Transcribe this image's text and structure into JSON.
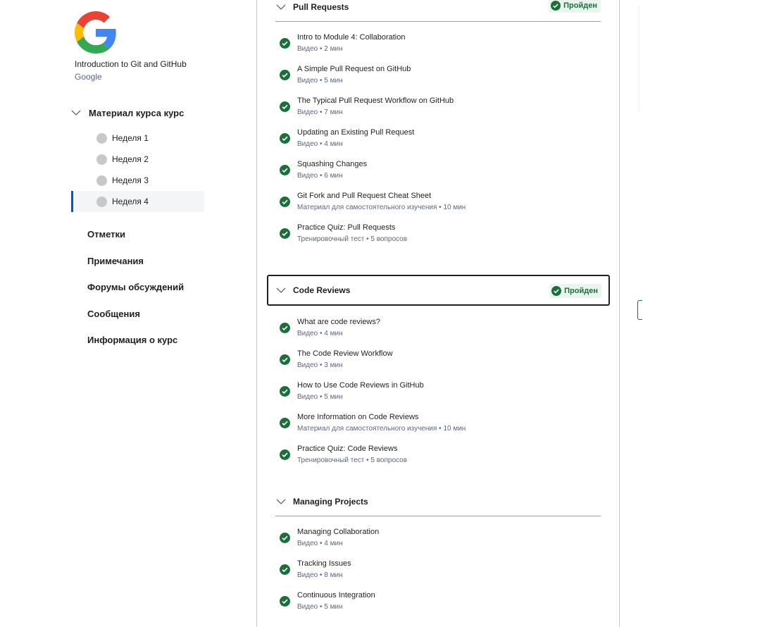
{
  "sidebar": {
    "course_title": "Introduction to Git and GitHub",
    "course_org": "Google",
    "material_label": "Материал курса курс",
    "weeks": [
      {
        "label": "Неделя 1"
      },
      {
        "label": "Неделя 2"
      },
      {
        "label": "Неделя 3"
      },
      {
        "label": "Неделя 4"
      }
    ],
    "links": [
      {
        "label": "Отметки"
      },
      {
        "label": "Примечания"
      },
      {
        "label": "Форумы обсуждений"
      },
      {
        "label": "Сообщения"
      },
      {
        "label": "Информация о курс"
      }
    ]
  },
  "status_label": "Пройден",
  "modules": [
    {
      "title": "Pull Requests",
      "items": [
        {
          "title": "Intro to Module 4: Collaboration",
          "meta": "Видео • 2 мин"
        },
        {
          "title": "A Simple Pull Request on GitHub",
          "meta": "Видео • 5 мин"
        },
        {
          "title": "The Typical Pull Request Workflow on GitHub",
          "meta": "Видео • 7 мин"
        },
        {
          "title": "Updating an Existing Pull Request",
          "meta": "Видео • 4 мин"
        },
        {
          "title": "Squashing Changes",
          "meta": "Видео • 6 мин"
        },
        {
          "title": "Git Fork and Pull Request Cheat Sheet",
          "meta": "Материал для самостоятельного изучения • 10 мин"
        },
        {
          "title": "Practice Quiz: Pull Requests",
          "meta": "Тренировочный тест • 5 вопросов"
        }
      ]
    },
    {
      "title": "Code Reviews",
      "items": [
        {
          "title": "What are code reviews?",
          "meta": "Видео • 4 мин"
        },
        {
          "title": "The Code Review Workflow",
          "meta": "Видео • 3 мин"
        },
        {
          "title": "How to Use Code Reviews in GitHub",
          "meta": "Видео • 5 мин"
        },
        {
          "title": "More Information on Code Reviews",
          "meta": "Материал для самостоятельного изучения • 10 мин"
        },
        {
          "title": "Practice Quiz: Code Reviews",
          "meta": "Тренировочный тест • 5 вопросов"
        }
      ]
    },
    {
      "title": "Managing Projects",
      "items": [
        {
          "title": "Managing Collaboration",
          "meta": "Видео • 4 мин"
        },
        {
          "title": "Tracking Issues",
          "meta": "Видео • 8 мин"
        },
        {
          "title": "Continuous Integration",
          "meta": "Видео • 5 мин"
        }
      ]
    }
  ],
  "colors": {
    "accent": "#0056d2",
    "success": "#1a6f3b",
    "badge_bg": "#eaf5ee"
  }
}
